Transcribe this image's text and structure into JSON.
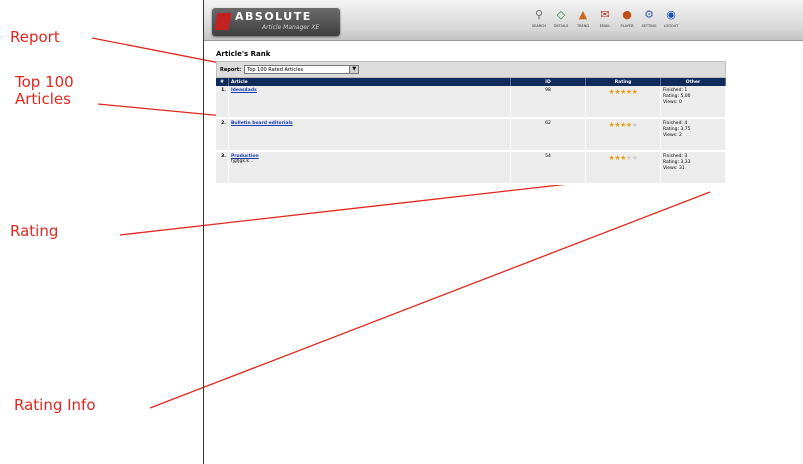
{
  "annotations": [
    {
      "id": "report",
      "text": "Report"
    },
    {
      "id": "top100",
      "text": "Top 100\nArticles"
    },
    {
      "id": "rating",
      "text": "Rating"
    },
    {
      "id": "rating_info",
      "text": "Rating Info"
    }
  ],
  "app": {
    "logo_name": "ABSOLUTE",
    "logo_tagline": "Article Manager XE",
    "toolbar": [
      {
        "label": "SEARCH",
        "icon": "search-icon",
        "glyph": "⚲",
        "color": "#6a6a6a"
      },
      {
        "label": "DETAILS",
        "icon": "details-icon",
        "glyph": "◇",
        "color": "#2c8a3a"
      },
      {
        "label": "TREND",
        "icon": "trend-icon",
        "glyph": "▲",
        "color": "#c9681e"
      },
      {
        "label": "EMAIL",
        "icon": "email-icon",
        "glyph": "✉",
        "color": "#b33a2a"
      },
      {
        "label": "PLAYER",
        "icon": "player-icon",
        "glyph": "●",
        "color": "#c14d18"
      },
      {
        "label": "SETTING",
        "icon": "settings-icon",
        "glyph": "⚙",
        "color": "#4a62a8"
      },
      {
        "label": "LOGOUT",
        "icon": "logout-icon",
        "glyph": "◉",
        "color": "#1e58b8"
      }
    ]
  },
  "page": {
    "title": "Article's Rank",
    "report_label": "Report:",
    "report_selected": "Top 100 Rated Articles"
  },
  "table": {
    "headers": [
      "#",
      "Article",
      "ID",
      "Rating",
      "Other"
    ],
    "rows": [
      {
        "num": "1.",
        "title": "Ideas4ads",
        "subtitle": "",
        "id": "98",
        "rating": 5,
        "other": [
          "Finished: 1",
          "Rating: 5,00",
          "Views: 0"
        ]
      },
      {
        "num": "2.",
        "title": "Bulletin board editorials",
        "subtitle": "",
        "id": "62",
        "rating": 4,
        "other": [
          "Finished: 4",
          "Rating: 3,75",
          "Views: 2"
        ]
      },
      {
        "num": "3.",
        "title": "Production",
        "subtitle": "fjgfjgk.k...",
        "id": "54",
        "rating": 3,
        "other": [
          "Finished: 3",
          "Rating: 3,33",
          "Views: 31"
        ]
      }
    ]
  },
  "colors": {
    "annotation": "#e0281e",
    "table_header": "#102a59",
    "star_on": "#e0a21c",
    "star_off": "#cfcfcf"
  }
}
